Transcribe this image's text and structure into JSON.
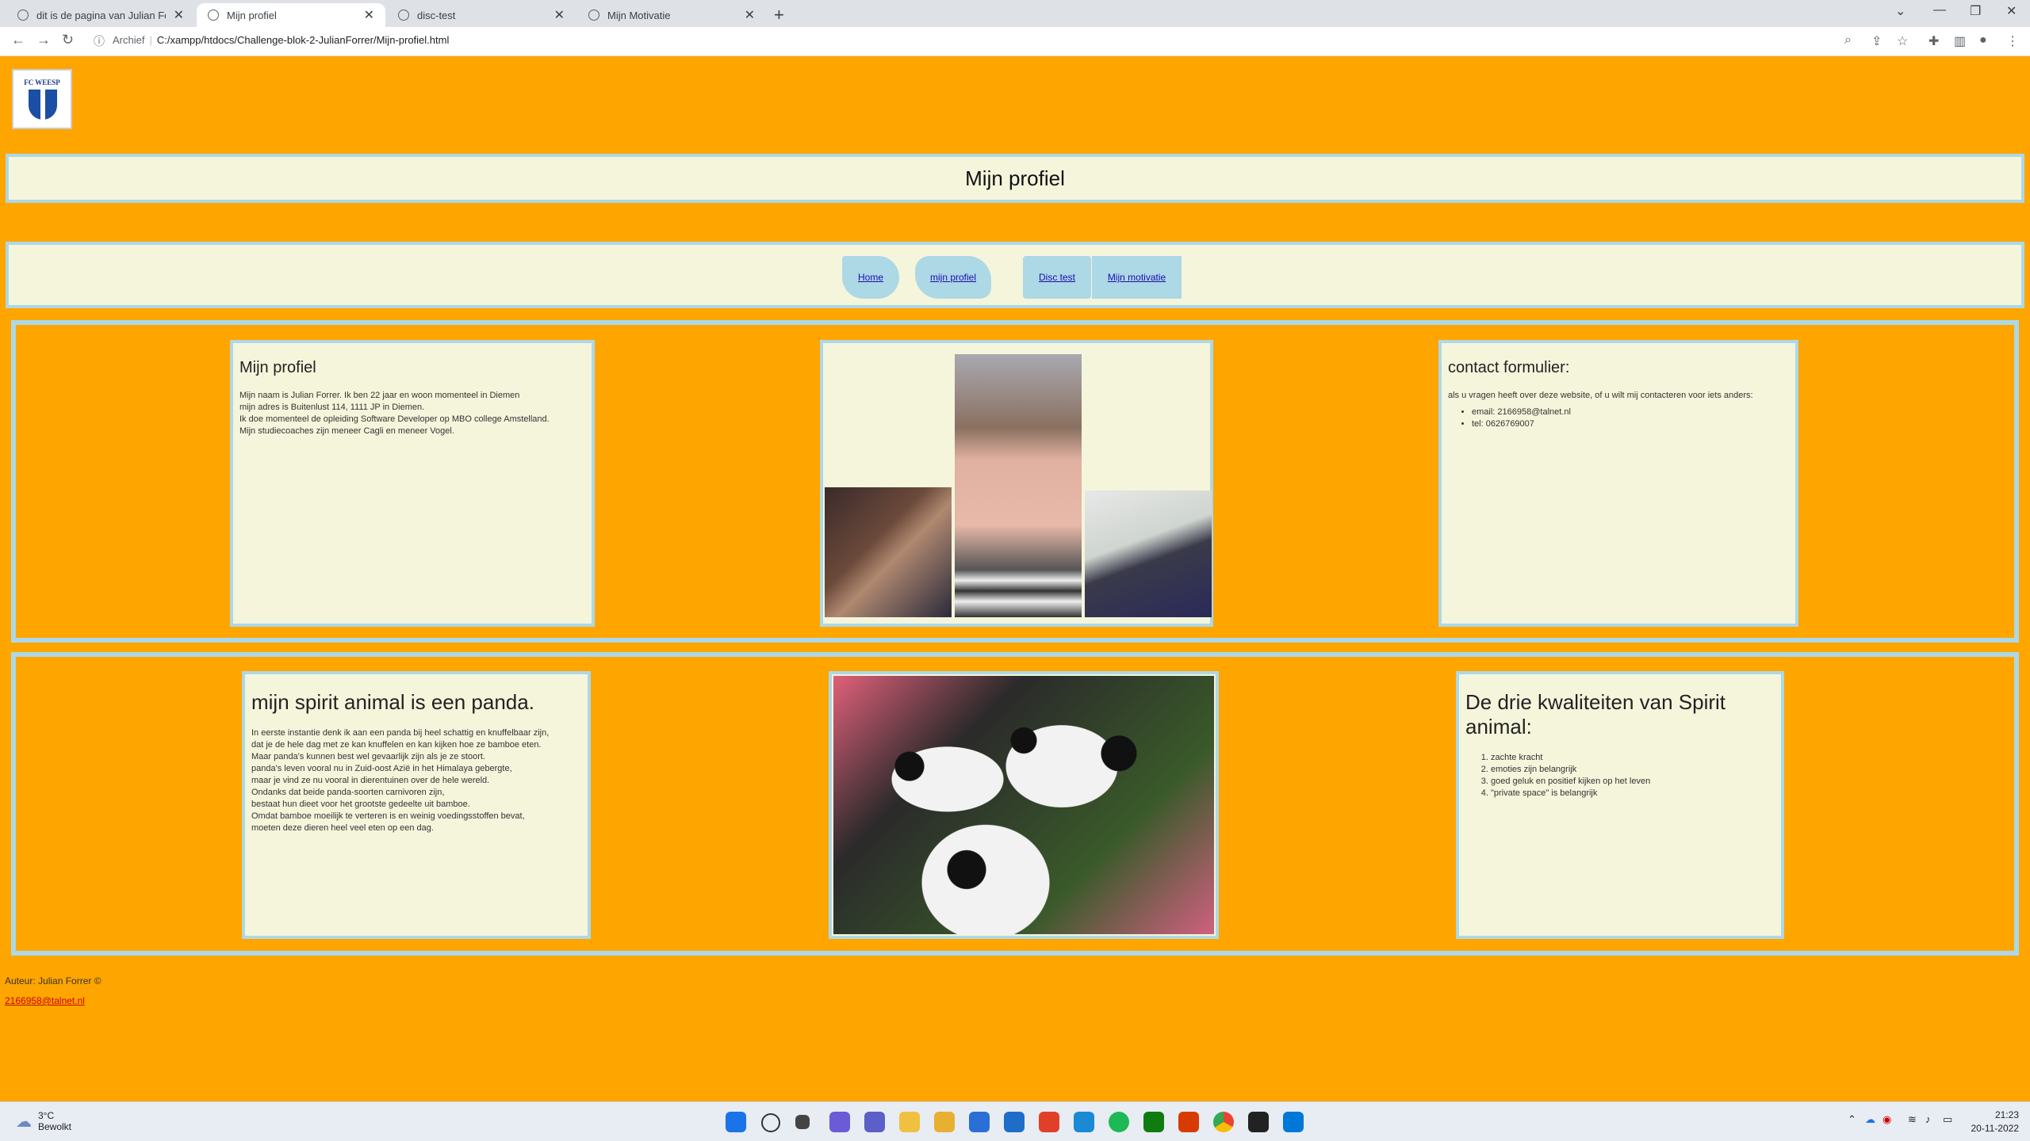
{
  "browser": {
    "tabs": [
      {
        "title": "dit is de pagina van Julian Forrer",
        "active": false
      },
      {
        "title": "Mijn profiel",
        "active": true
      },
      {
        "title": "disc-test",
        "active": false
      },
      {
        "title": "Mijn Motivatie",
        "active": false
      }
    ],
    "new_tab_label": "+",
    "address": {
      "scheme_label": "Archief",
      "path": "C:/xampp/htdocs/Challenge-blok-2-JulianForrer/Mijn-profiel.html"
    }
  },
  "page": {
    "logo_text": "FC WEESP",
    "title": "Mijn profiel",
    "nav": [
      {
        "label": "Home"
      },
      {
        "label": "mijn profiel"
      },
      {
        "label": "Disc test"
      },
      {
        "label": "Mijn motivatie"
      }
    ],
    "profile_card": {
      "heading": "Mijn profiel",
      "text": "Mijn naam is Julian Forrer. Ik ben 22 jaar en woon momenteel in Diemen\nmijn adres is Buitenlust 114, 1111 JP in Diemen.\nIk doe momenteel de opleiding Software Developer op MBO college Amstelland.\nMijn studiecoaches zijn meneer Cagli en meneer Vogel."
    },
    "contact_card": {
      "heading": "contact formulier:",
      "intro": "als u vragen heeft over deze website, of u wilt mij contacteren voor iets anders:",
      "items": [
        "email: 2166958@talnet.nl",
        "tel: 0626769007"
      ]
    },
    "spirit_card": {
      "heading": "mijn spirit animal is een panda.",
      "text": "In eerste instantie denk ik aan een panda bij heel schattig en knuffelbaar zijn,\ndat je de hele dag met ze kan knuffelen en kan kijken hoe ze bamboe eten.\nMaar panda's kunnen best wel gevaarlijk zijn als je ze stoort.\npanda's leven vooral nu in Zuid-oost Azië in het Himalaya gebergte,\nmaar je vind ze nu vooral in dierentuinen over de hele wereld.\nOndanks dat beide panda-soorten carnivoren zijn,\nbestaat hun dieet voor het grootste gedeelte uit bamboe.\nOmdat bamboe moeilijk te verteren is en weinig voedingsstoffen bevat,\nmoeten deze dieren heel veel eten op een dag."
    },
    "qualities_card": {
      "heading": "De drie kwaliteiten van Spirit animal:",
      "items": [
        "zachte kracht",
        "emoties zijn belangrijk",
        "goed geluk en positief kijken op het leven",
        "\"private space\" is belangrijk"
      ]
    },
    "footer": {
      "author": "Auteur: Julian Forrer ©",
      "email": "2166958@talnet.nl"
    }
  },
  "taskbar": {
    "weather_temp": "3°C",
    "weather_desc": "Bewolkt",
    "time": "21:23",
    "date": "20-11-2022"
  },
  "colors": {
    "page_bg": "#ffa500",
    "card_bg": "#f5f5dc",
    "border": "#add8e6"
  }
}
